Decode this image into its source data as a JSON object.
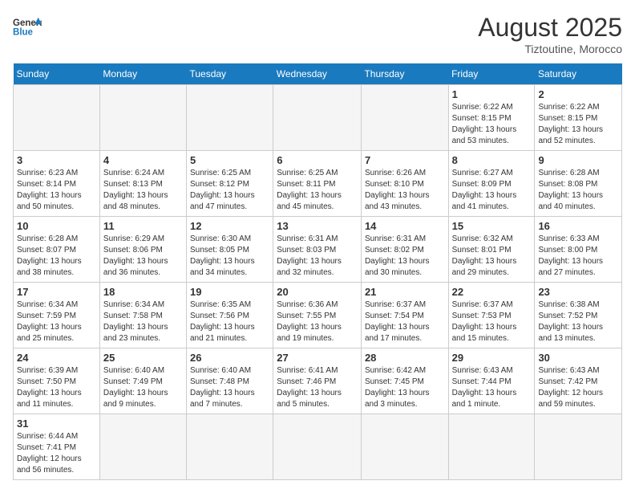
{
  "header": {
    "logo_general": "General",
    "logo_blue": "Blue",
    "month_year": "August 2025",
    "location": "Tiztoutine, Morocco"
  },
  "weekdays": [
    "Sunday",
    "Monday",
    "Tuesday",
    "Wednesday",
    "Thursday",
    "Friday",
    "Saturday"
  ],
  "weeks": [
    [
      {
        "day": "",
        "info": ""
      },
      {
        "day": "",
        "info": ""
      },
      {
        "day": "",
        "info": ""
      },
      {
        "day": "",
        "info": ""
      },
      {
        "day": "",
        "info": ""
      },
      {
        "day": "1",
        "info": "Sunrise: 6:22 AM\nSunset: 8:15 PM\nDaylight: 13 hours\nand 53 minutes."
      },
      {
        "day": "2",
        "info": "Sunrise: 6:22 AM\nSunset: 8:15 PM\nDaylight: 13 hours\nand 52 minutes."
      }
    ],
    [
      {
        "day": "3",
        "info": "Sunrise: 6:23 AM\nSunset: 8:14 PM\nDaylight: 13 hours\nand 50 minutes."
      },
      {
        "day": "4",
        "info": "Sunrise: 6:24 AM\nSunset: 8:13 PM\nDaylight: 13 hours\nand 48 minutes."
      },
      {
        "day": "5",
        "info": "Sunrise: 6:25 AM\nSunset: 8:12 PM\nDaylight: 13 hours\nand 47 minutes."
      },
      {
        "day": "6",
        "info": "Sunrise: 6:25 AM\nSunset: 8:11 PM\nDaylight: 13 hours\nand 45 minutes."
      },
      {
        "day": "7",
        "info": "Sunrise: 6:26 AM\nSunset: 8:10 PM\nDaylight: 13 hours\nand 43 minutes."
      },
      {
        "day": "8",
        "info": "Sunrise: 6:27 AM\nSunset: 8:09 PM\nDaylight: 13 hours\nand 41 minutes."
      },
      {
        "day": "9",
        "info": "Sunrise: 6:28 AM\nSunset: 8:08 PM\nDaylight: 13 hours\nand 40 minutes."
      }
    ],
    [
      {
        "day": "10",
        "info": "Sunrise: 6:28 AM\nSunset: 8:07 PM\nDaylight: 13 hours\nand 38 minutes."
      },
      {
        "day": "11",
        "info": "Sunrise: 6:29 AM\nSunset: 8:06 PM\nDaylight: 13 hours\nand 36 minutes."
      },
      {
        "day": "12",
        "info": "Sunrise: 6:30 AM\nSunset: 8:05 PM\nDaylight: 13 hours\nand 34 minutes."
      },
      {
        "day": "13",
        "info": "Sunrise: 6:31 AM\nSunset: 8:03 PM\nDaylight: 13 hours\nand 32 minutes."
      },
      {
        "day": "14",
        "info": "Sunrise: 6:31 AM\nSunset: 8:02 PM\nDaylight: 13 hours\nand 30 minutes."
      },
      {
        "day": "15",
        "info": "Sunrise: 6:32 AM\nSunset: 8:01 PM\nDaylight: 13 hours\nand 29 minutes."
      },
      {
        "day": "16",
        "info": "Sunrise: 6:33 AM\nSunset: 8:00 PM\nDaylight: 13 hours\nand 27 minutes."
      }
    ],
    [
      {
        "day": "17",
        "info": "Sunrise: 6:34 AM\nSunset: 7:59 PM\nDaylight: 13 hours\nand 25 minutes."
      },
      {
        "day": "18",
        "info": "Sunrise: 6:34 AM\nSunset: 7:58 PM\nDaylight: 13 hours\nand 23 minutes."
      },
      {
        "day": "19",
        "info": "Sunrise: 6:35 AM\nSunset: 7:56 PM\nDaylight: 13 hours\nand 21 minutes."
      },
      {
        "day": "20",
        "info": "Sunrise: 6:36 AM\nSunset: 7:55 PM\nDaylight: 13 hours\nand 19 minutes."
      },
      {
        "day": "21",
        "info": "Sunrise: 6:37 AM\nSunset: 7:54 PM\nDaylight: 13 hours\nand 17 minutes."
      },
      {
        "day": "22",
        "info": "Sunrise: 6:37 AM\nSunset: 7:53 PM\nDaylight: 13 hours\nand 15 minutes."
      },
      {
        "day": "23",
        "info": "Sunrise: 6:38 AM\nSunset: 7:52 PM\nDaylight: 13 hours\nand 13 minutes."
      }
    ],
    [
      {
        "day": "24",
        "info": "Sunrise: 6:39 AM\nSunset: 7:50 PM\nDaylight: 13 hours\nand 11 minutes."
      },
      {
        "day": "25",
        "info": "Sunrise: 6:40 AM\nSunset: 7:49 PM\nDaylight: 13 hours\nand 9 minutes."
      },
      {
        "day": "26",
        "info": "Sunrise: 6:40 AM\nSunset: 7:48 PM\nDaylight: 13 hours\nand 7 minutes."
      },
      {
        "day": "27",
        "info": "Sunrise: 6:41 AM\nSunset: 7:46 PM\nDaylight: 13 hours\nand 5 minutes."
      },
      {
        "day": "28",
        "info": "Sunrise: 6:42 AM\nSunset: 7:45 PM\nDaylight: 13 hours\nand 3 minutes."
      },
      {
        "day": "29",
        "info": "Sunrise: 6:43 AM\nSunset: 7:44 PM\nDaylight: 13 hours\nand 1 minute."
      },
      {
        "day": "30",
        "info": "Sunrise: 6:43 AM\nSunset: 7:42 PM\nDaylight: 12 hours\nand 59 minutes."
      }
    ],
    [
      {
        "day": "31",
        "info": "Sunrise: 6:44 AM\nSunset: 7:41 PM\nDaylight: 12 hours\nand 56 minutes."
      },
      {
        "day": "",
        "info": ""
      },
      {
        "day": "",
        "info": ""
      },
      {
        "day": "",
        "info": ""
      },
      {
        "day": "",
        "info": ""
      },
      {
        "day": "",
        "info": ""
      },
      {
        "day": "",
        "info": ""
      }
    ]
  ]
}
